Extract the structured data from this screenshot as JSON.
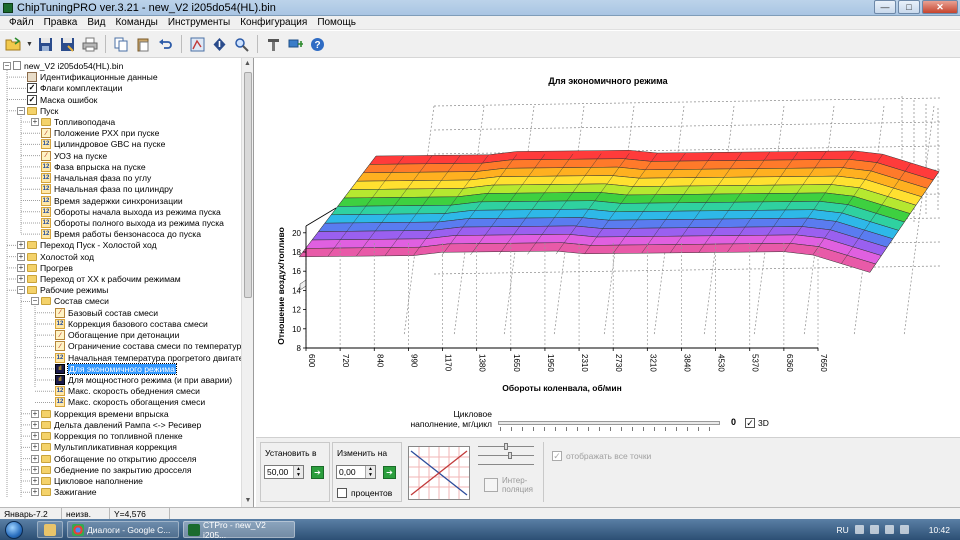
{
  "window": {
    "title": "ChipTuningPRO ver.3.21 - new_V2  i205do54(HL).bin",
    "buttons": {
      "minimize": "—",
      "maximize": "□",
      "close": "✕"
    }
  },
  "menu": [
    "Файл",
    "Правка",
    "Вид",
    "Команды",
    "Инструменты",
    "Конфигурация",
    "Помощь"
  ],
  "toolbar_icons": [
    "open-folder-icon",
    "save-icon",
    "save-as-icon",
    "print-icon",
    "copy-icon",
    "paste-icon",
    "undo-icon",
    "calibrate-icon",
    "info-icon",
    "search-icon",
    "tools-icon",
    "connect-icon",
    "help-icon"
  ],
  "tree": {
    "root": "new_V2  i205do54(HL).bin",
    "items": [
      {
        "text": "Идентификационные данные",
        "level": 1,
        "icon": "ident",
        "box": ""
      },
      {
        "text": "Флаги комплектации",
        "level": 1,
        "icon": "check",
        "box": ""
      },
      {
        "text": "Маска ошибок",
        "level": 1,
        "icon": "check",
        "box": ""
      },
      {
        "text": "Пуск",
        "level": 1,
        "icon": "folder",
        "box": "−"
      },
      {
        "text": "Топливоподача",
        "level": 2,
        "icon": "folder",
        "box": "+"
      },
      {
        "text": "Положение РХХ при пуске",
        "level": 2,
        "icon": "doc",
        "box": ""
      },
      {
        "text": "Цилиндровое GBC на пуске",
        "level": 2,
        "icon": "12",
        "box": ""
      },
      {
        "text": "УОЗ на пуске",
        "level": 2,
        "icon": "doc",
        "box": ""
      },
      {
        "text": "Фаза впрыска на пуске",
        "level": 2,
        "icon": "12",
        "box": ""
      },
      {
        "text": "Начальная фаза по углу",
        "level": 2,
        "icon": "12",
        "box": ""
      },
      {
        "text": "Начальная фаза по цилиндру",
        "level": 2,
        "icon": "12",
        "box": ""
      },
      {
        "text": "Время задержки синхронизации",
        "level": 2,
        "icon": "12",
        "box": ""
      },
      {
        "text": "Обороты начала выхода из режима пуска",
        "level": 2,
        "icon": "12",
        "box": ""
      },
      {
        "text": "Обороты полного выхода из режима пуска",
        "level": 2,
        "icon": "12",
        "box": ""
      },
      {
        "text": "Время работы бензонасоса до пуска",
        "level": 2,
        "icon": "12",
        "box": ""
      },
      {
        "text": "Переход Пуск - Холостой ход",
        "level": 1,
        "icon": "folder",
        "box": "+"
      },
      {
        "text": "Холостой ход",
        "level": 1,
        "icon": "folder",
        "box": "+"
      },
      {
        "text": "Прогрев",
        "level": 1,
        "icon": "folder",
        "box": "+"
      },
      {
        "text": "Переход от ХХ к рабочим режимам",
        "level": 1,
        "icon": "folder",
        "box": "+"
      },
      {
        "text": "Рабочие режимы",
        "level": 1,
        "icon": "folder",
        "box": "−"
      },
      {
        "text": "Состав смеси",
        "level": 2,
        "icon": "folder",
        "box": "−"
      },
      {
        "text": "Базовый состав смеси",
        "level": 3,
        "icon": "doc",
        "box": ""
      },
      {
        "text": "Коррекция базового состава смеси",
        "level": 3,
        "icon": "12",
        "box": ""
      },
      {
        "text": "Обогащение при детонации",
        "level": 3,
        "icon": "doc",
        "box": ""
      },
      {
        "text": "Ограничение состава смеси по температуре",
        "level": 3,
        "icon": "doc",
        "box": ""
      },
      {
        "text": "Начальная температура прогретого двигателя",
        "level": 3,
        "icon": "12",
        "box": ""
      },
      {
        "text": "Для экономичного режима",
        "level": 3,
        "icon": "3d",
        "box": "",
        "selected": true
      },
      {
        "text": "Для мощностного режима (и при аварии)",
        "level": 3,
        "icon": "3d",
        "box": ""
      },
      {
        "text": "Макс. скорость обеднения смеси",
        "level": 3,
        "icon": "12",
        "box": ""
      },
      {
        "text": "Макс. скорость обогащения смеси",
        "level": 3,
        "icon": "12",
        "box": ""
      },
      {
        "text": "Коррекция времени впрыска",
        "level": 2,
        "icon": "folder",
        "box": "+"
      },
      {
        "text": "Дельта давлений Рампа <-> Ресивер",
        "level": 2,
        "icon": "folder",
        "box": "+"
      },
      {
        "text": "Коррекция по топливной пленке",
        "level": 2,
        "icon": "folder",
        "box": "+"
      },
      {
        "text": "Мультипликативная коррекция",
        "level": 2,
        "icon": "folder",
        "box": "+"
      },
      {
        "text": "Обогащение по открытию дросселя",
        "level": 2,
        "icon": "folder",
        "box": "+"
      },
      {
        "text": "Обеднение по закрытию дросселя",
        "level": 2,
        "icon": "folder",
        "box": "+"
      },
      {
        "text": "Цикловое наполнение",
        "level": 2,
        "icon": "folder",
        "box": "+"
      },
      {
        "text": "Зажигание",
        "level": 2,
        "icon": "folder",
        "box": "+"
      }
    ]
  },
  "chart": {
    "title": "Для экономичного режима",
    "ylabel": "Отношение воздух/топливо",
    "xlabel": "Обороты коленвала, об/мин",
    "y_ticks": [
      "8",
      "10",
      "12",
      "14",
      "16",
      "18",
      "20"
    ],
    "x_ticks": [
      "600",
      "720",
      "840",
      "990",
      "1170",
      "1380",
      "1650",
      "1950",
      "2310",
      "2730",
      "3210",
      "3840",
      "4530",
      "5370",
      "6360",
      "7650"
    ]
  },
  "slider": {
    "label": "Цикловое наполнение, мг/цикл",
    "value": "0",
    "checkbox_3d_label": "3D",
    "checkbox_3d_checked": true
  },
  "controls": {
    "set_label": "Установить в",
    "set_value": "50,00",
    "change_label": "Изменить на",
    "change_value": "0,00",
    "percent_label": "процентов",
    "interp_label": "Интер-\nполяция",
    "all_points_label": "отображать все точки",
    "go_symbol": "➔"
  },
  "status": {
    "mode": "Январь-7.2",
    "software": "неизв. ПО",
    "y_value": "Y=4,576"
  },
  "taskbar": {
    "tasks": [
      "Диалоги - Google C...",
      "CTPro - new_V2  i205..."
    ],
    "lang": "RU",
    "time": "10:42"
  }
}
